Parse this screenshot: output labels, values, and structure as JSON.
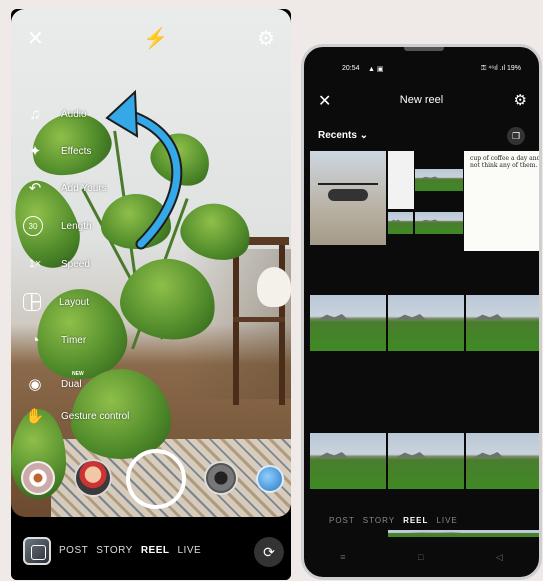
{
  "left_phone": {
    "top_icons": {
      "close": "✕",
      "flash_off": "⚡",
      "settings": "⚙"
    },
    "menu": [
      {
        "icon": "♫",
        "label": "Audio"
      },
      {
        "icon": "✦",
        "label": "Effects"
      },
      {
        "icon": "↶",
        "label": "Add Yours"
      },
      {
        "icon": "30",
        "label": "Length"
      },
      {
        "icon": "1×",
        "label": "Speed"
      },
      {
        "icon": "",
        "label": "Layout"
      },
      {
        "icon": "◔",
        "label": "Timer"
      },
      {
        "icon": "◉",
        "label": "Dual"
      },
      {
        "icon": "✋",
        "label": "Gesture control"
      }
    ],
    "new_badge": "NEW",
    "modes": [
      "POST",
      "STORY",
      "REEL",
      "LIVE"
    ],
    "active_mode": "REEL",
    "flip_icon": "⟳",
    "arrow_color": "#35a9e8"
  },
  "right_phone": {
    "status": {
      "time": "20:54",
      "dots": "▲ ▣",
      "right": "⚿ ⁴⁶ıl .ıl 19%"
    },
    "close": "✕",
    "title": "New reel",
    "settings": "⚙",
    "recents": "Recents ⌄",
    "multi_select": "❐",
    "doc_text": "cup of coffee a day and not think any of them.",
    "modes": [
      "POST",
      "STORY",
      "REEL",
      "LIVE"
    ],
    "active_mode": "REEL",
    "nav": [
      "≡",
      "□",
      "◁"
    ]
  }
}
